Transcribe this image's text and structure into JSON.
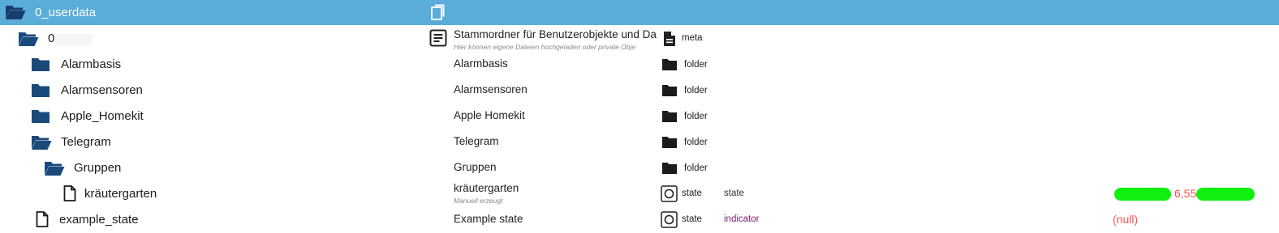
{
  "root": {
    "name": "0_userdata",
    "icon": "folder-open-icon",
    "copy_icon": "copy-icon"
  },
  "rows": [
    {
      "name": "0",
      "icon": "folder-open-icon",
      "display": "Stammordner für Benutzerobjekte und Da",
      "subtitle": "Hier können eigene Dateien hochgeladen oder private Obje",
      "type": "meta",
      "type_icon": "file-text-icon",
      "meta_icon": "document-lines-icon"
    },
    {
      "name": "Alarmbasis",
      "icon": "folder-icon",
      "display": "Alarmbasis",
      "type": "folder",
      "type_icon": "folder-icon"
    },
    {
      "name": "Alarmsensoren",
      "icon": "folder-icon",
      "display": "Alarmsensoren",
      "type": "folder",
      "type_icon": "folder-icon"
    },
    {
      "name": "Apple_Homekit",
      "icon": "folder-icon",
      "display": "Apple Homekit",
      "type": "folder",
      "type_icon": "folder-icon"
    },
    {
      "name": "Telegram",
      "icon": "folder-open-icon",
      "display": "Telegram",
      "type": "folder",
      "type_icon": "folder-icon"
    },
    {
      "name": "Gruppen",
      "icon": "folder-open-icon",
      "display": "Gruppen",
      "type": "folder",
      "type_icon": "folder-icon"
    },
    {
      "name": "kräutergarten",
      "icon": "file-icon",
      "display": "kräutergarten",
      "subtitle": "Manuell erzeugt",
      "type": "state",
      "type_icon": "state-circle-icon",
      "role": "state",
      "value": "6,55"
    },
    {
      "name": "example_state",
      "icon": "file-icon",
      "display": "Example state",
      "type": "state",
      "type_icon": "state-circle-icon",
      "role": "indicator",
      "value": "(null)"
    }
  ],
  "colors": {
    "header_bg": "#5aadd8",
    "folder_icon": "#1a4a7a",
    "value": "#ee5555",
    "redaction": "#10f010"
  }
}
